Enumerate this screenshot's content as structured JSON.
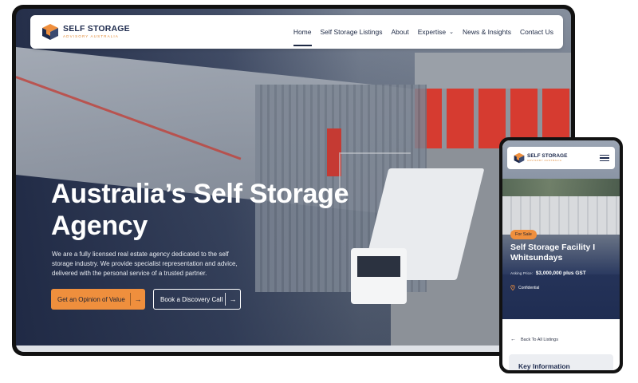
{
  "brand": {
    "title": "SELF STORAGE",
    "subtitle": "ADVISORY AUSTRALIA",
    "accent_color": "#ef8f3d",
    "navy_color": "#1d2a4d"
  },
  "desktop": {
    "nav": {
      "items": [
        {
          "label": "Home",
          "active": true
        },
        {
          "label": "Self Storage Listings"
        },
        {
          "label": "About"
        },
        {
          "label": "Expertise",
          "has_dropdown": true,
          "icon": "chevron-down-icon"
        },
        {
          "label": "News & Insights"
        },
        {
          "label": "Contact Us"
        }
      ]
    },
    "hero": {
      "title": "Australia’s Self Storage Agency",
      "description": "We are a fully licensed real estate agency dedicated to the self storage industry. We provide specialist representation and advice, delivered with the personal service of a trusted partner.",
      "primary_button": "Get an Opinion of Value",
      "secondary_button": "Book a Discovery Call",
      "button_icon": "arrow-right-icon"
    }
  },
  "mobile": {
    "menu_icon": "hamburger-menu-icon",
    "badge": "For Sale",
    "listing_title": "Self Storage Facility I Whitsundays",
    "price_label": "Asking Price:",
    "price_value": "$3,000,000 plus GST",
    "location_icon": "map-pin-icon",
    "location": "Confidential",
    "back_link": "Back To All Listings",
    "card_title": "Key Information"
  }
}
